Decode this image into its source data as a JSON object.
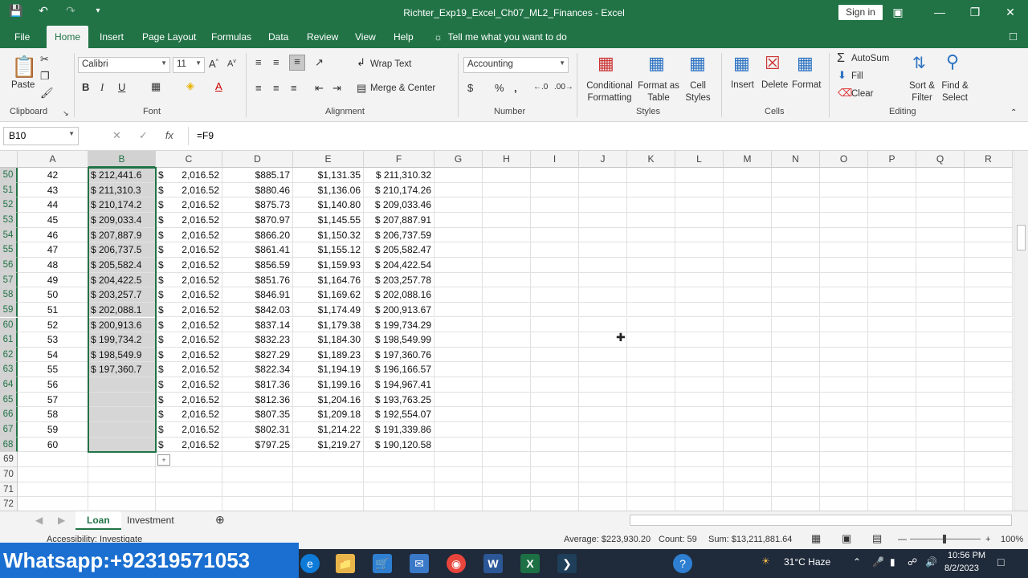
{
  "window": {
    "title": "Richter_Exp19_Excel_Ch07_ML2_Finances  -  Excel",
    "signin_label": "Sign in"
  },
  "tabs": [
    {
      "label": "File"
    },
    {
      "label": "Home"
    },
    {
      "label": "Insert"
    },
    {
      "label": "Page Layout"
    },
    {
      "label": "Formulas"
    },
    {
      "label": "Data"
    },
    {
      "label": "Review"
    },
    {
      "label": "View"
    },
    {
      "label": "Help"
    }
  ],
  "tellme": "Tell me what you want to do",
  "ribbon": {
    "clipboard": {
      "paste": "Paste",
      "label": "Clipboard"
    },
    "font": {
      "name": "Calibri",
      "size": "11",
      "label": "Font"
    },
    "alignment": {
      "wrap": "Wrap Text",
      "merge": "Merge & Center",
      "label": "Alignment"
    },
    "number": {
      "format": "Accounting",
      "label": "Number"
    },
    "styles": {
      "cond": "Conditional",
      "cond2": "Formatting",
      "fmt": "Format as",
      "fmt2": "Table",
      "cell": "Cell",
      "cell2": "Styles",
      "label": "Styles"
    },
    "cells": {
      "insert": "Insert",
      "delete": "Delete",
      "format": "Format",
      "label": "Cells"
    },
    "editing": {
      "autosum": "AutoSum",
      "fill": "Fill",
      "clear": "Clear",
      "sort": "Sort &",
      "sort2": "Filter",
      "find": "Find &",
      "find2": "Select",
      "label": "Editing"
    }
  },
  "formula_bar": {
    "name_box": "B10",
    "formula": "=F9"
  },
  "columns": [
    "A",
    "B",
    "C",
    "D",
    "E",
    "F",
    "G",
    "H",
    "I",
    "J",
    "K",
    "L",
    "M",
    "N",
    "O",
    "P",
    "Q",
    "R"
  ],
  "rows": [
    {
      "n": "50",
      "a": "42",
      "b": "$ 212,441.6",
      "c": "2,016.52",
      "d": "$885.17",
      "e": "$1,131.35",
      "f": "$ 211,310.32"
    },
    {
      "n": "51",
      "a": "43",
      "b": "$ 211,310.3",
      "c": "2,016.52",
      "d": "$880.46",
      "e": "$1,136.06",
      "f": "$ 210,174.26"
    },
    {
      "n": "52",
      "a": "44",
      "b": "$ 210,174.2",
      "c": "2,016.52",
      "d": "$875.73",
      "e": "$1,140.80",
      "f": "$ 209,033.46"
    },
    {
      "n": "53",
      "a": "45",
      "b": "$ 209,033.4",
      "c": "2,016.52",
      "d": "$870.97",
      "e": "$1,145.55",
      "f": "$ 207,887.91"
    },
    {
      "n": "54",
      "a": "46",
      "b": "$ 207,887.9",
      "c": "2,016.52",
      "d": "$866.20",
      "e": "$1,150.32",
      "f": "$ 206,737.59"
    },
    {
      "n": "55",
      "a": "47",
      "b": "$ 206,737.5",
      "c": "2,016.52",
      "d": "$861.41",
      "e": "$1,155.12",
      "f": "$ 205,582.47"
    },
    {
      "n": "56",
      "a": "48",
      "b": "$ 205,582.4",
      "c": "2,016.52",
      "d": "$856.59",
      "e": "$1,159.93",
      "f": "$ 204,422.54"
    },
    {
      "n": "57",
      "a": "49",
      "b": "$ 204,422.5",
      "c": "2,016.52",
      "d": "$851.76",
      "e": "$1,164.76",
      "f": "$ 203,257.78"
    },
    {
      "n": "58",
      "a": "50",
      "b": "$ 203,257.7",
      "c": "2,016.52",
      "d": "$846.91",
      "e": "$1,169.62",
      "f": "$ 202,088.16"
    },
    {
      "n": "59",
      "a": "51",
      "b": "$ 202,088.1",
      "c": "2,016.52",
      "d": "$842.03",
      "e": "$1,174.49",
      "f": "$ 200,913.67"
    },
    {
      "n": "60",
      "a": "52",
      "b": "$ 200,913.6",
      "c": "2,016.52",
      "d": "$837.14",
      "e": "$1,179.38",
      "f": "$ 199,734.29"
    },
    {
      "n": "61",
      "a": "53",
      "b": "$ 199,734.2",
      "c": "2,016.52",
      "d": "$832.23",
      "e": "$1,184.30",
      "f": "$ 198,549.99"
    },
    {
      "n": "62",
      "a": "54",
      "b": "$ 198,549.9",
      "c": "2,016.52",
      "d": "$827.29",
      "e": "$1,189.23",
      "f": "$ 197,360.76"
    },
    {
      "n": "63",
      "a": "55",
      "b": "$ 197,360.7",
      "c": "2,016.52",
      "d": "$822.34",
      "e": "$1,194.19",
      "f": "$ 196,166.57"
    },
    {
      "n": "64",
      "a": "56",
      "b": "",
      "c": "2,016.52",
      "d": "$817.36",
      "e": "$1,199.16",
      "f": "$ 194,967.41"
    },
    {
      "n": "65",
      "a": "57",
      "b": "",
      "c": "2,016.52",
      "d": "$812.36",
      "e": "$1,204.16",
      "f": "$ 193,763.25"
    },
    {
      "n": "66",
      "a": "58",
      "b": "",
      "c": "2,016.52",
      "d": "$807.35",
      "e": "$1,209.18",
      "f": "$ 192,554.07"
    },
    {
      "n": "67",
      "a": "59",
      "b": "",
      "c": "2,016.52",
      "d": "$802.31",
      "e": "$1,214.22",
      "f": "$ 191,339.86"
    },
    {
      "n": "68",
      "a": "60",
      "b": "",
      "c": "2,016.52",
      "d": "$797.25",
      "e": "$1,219.27",
      "f": "$ 190,120.58"
    },
    {
      "n": "69",
      "a": "",
      "b": "",
      "c": "",
      "d": "",
      "e": "",
      "f": ""
    },
    {
      "n": "70",
      "a": "",
      "b": "",
      "c": "",
      "d": "",
      "e": "",
      "f": ""
    },
    {
      "n": "71",
      "a": "",
      "b": "",
      "c": "",
      "d": "",
      "e": "",
      "f": ""
    },
    {
      "n": "72",
      "a": "",
      "b": "",
      "c": "",
      "d": "",
      "e": "",
      "f": ""
    }
  ],
  "sheets": {
    "active": "Loan",
    "other": "Investment"
  },
  "status": {
    "accessibility": "Accessibility: Investigate",
    "average": "Average: $223,930.20",
    "count": "Count: 59",
    "sum": "Sum: $13,211,881.64",
    "zoom": "100%"
  },
  "taskbar": {
    "overlay": "Whatsapp:+923195710​53",
    "weather": "31°C  Haze",
    "time": "10:56 PM",
    "date": "8/2/2023"
  }
}
